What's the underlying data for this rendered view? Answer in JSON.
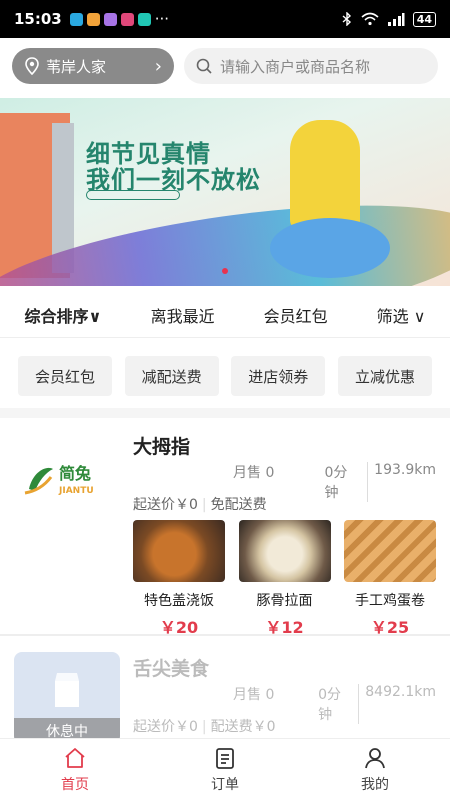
{
  "status": {
    "time": "15:03",
    "battery": "44",
    "dots": "···"
  },
  "header": {
    "location": "苇岸人家",
    "search_placeholder": "请输入商户或商品名称"
  },
  "banner": {
    "line1": "细节见真情",
    "line2": "我们一刻不放松"
  },
  "sort": {
    "items": [
      {
        "label": "综合排序",
        "arrow": "∨"
      },
      {
        "label": "离我最近"
      },
      {
        "label": "会员红包"
      },
      {
        "label": "筛选",
        "arrow": "∨"
      }
    ]
  },
  "filters": [
    "会员红包",
    "减配送费",
    "进店领券",
    "立减优惠"
  ],
  "stores": [
    {
      "name": "大拇指",
      "logo_text": "简兔",
      "logo_sub": "JIANTU",
      "sales": "月售 0",
      "time": "0分钟",
      "distance": "193.9km",
      "min_order": "起送价￥0",
      "delivery_fee": "免配送费",
      "dishes": [
        {
          "name": "特色盖浇饭",
          "price": "￥20"
        },
        {
          "name": "豚骨拉面",
          "price": "￥12"
        },
        {
          "name": "手工鸡蛋卷",
          "price": "￥25"
        }
      ]
    },
    {
      "name": "舌尖美食",
      "status": "休息中",
      "sales": "月售 0",
      "time": "0分钟",
      "distance": "8492.1km",
      "min_order": "起送价￥0",
      "delivery_fee": "配送费￥0"
    }
  ],
  "tabs": [
    {
      "label": "首页",
      "icon": "home-icon"
    },
    {
      "label": "订单",
      "icon": "order-icon"
    },
    {
      "label": "我的",
      "icon": "user-icon"
    }
  ],
  "colors": {
    "accent": "#e23c4c",
    "banner_text": "#25856d"
  }
}
